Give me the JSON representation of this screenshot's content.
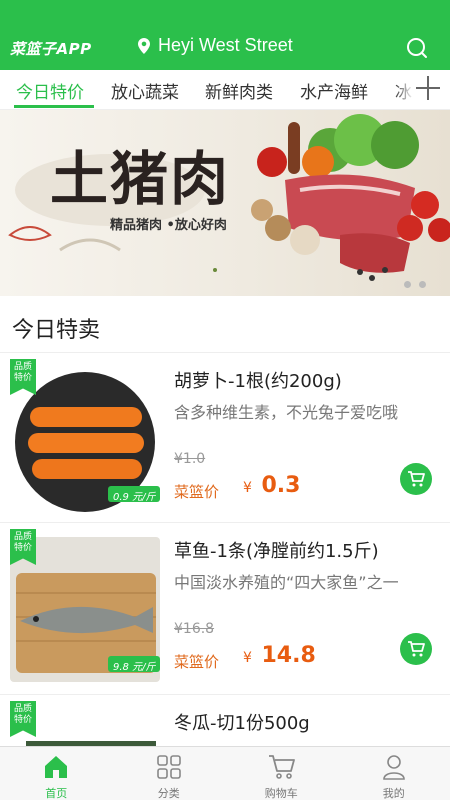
{
  "header": {
    "logo": "菜篮子APP",
    "location": "Heyi West Street"
  },
  "tabs": [
    "今日特价",
    "放心蔬菜",
    "新鲜肉类",
    "水产海鲜",
    "冰"
  ],
  "banner": {
    "title": "土猪肉",
    "subtitle": "精品猪肉 •放心好肉"
  },
  "section": {
    "title": "今日特卖"
  },
  "products": [
    {
      "tag": "品质特价",
      "name": "胡萝卜-1根(约200g)",
      "desc": "含多种维生素，不光兔子爱吃哦",
      "old_price": "¥1.0",
      "label": "菜篮价",
      "currency": "¥",
      "price": "0.3",
      "badge_price": "0.9",
      "badge_unit": "元/斤"
    },
    {
      "tag": "品质特价",
      "name": "草鱼-1条(净膛前约1.5斤)",
      "desc": "中国淡水养殖的“四大家鱼”之一",
      "old_price": "¥16.8",
      "label": "菜篮价",
      "currency": "¥",
      "price": "14.8",
      "badge_price": "9.8",
      "badge_unit": "元/斤"
    },
    {
      "tag": "品质特价",
      "name": "冬瓜-切1份500g"
    }
  ],
  "nav": [
    {
      "label": "首页",
      "icon": "home-icon",
      "active": true
    },
    {
      "label": "分类",
      "icon": "category-icon",
      "active": false
    },
    {
      "label": "购物车",
      "icon": "cart-icon",
      "active": false
    },
    {
      "label": "我的",
      "icon": "user-icon",
      "active": false
    }
  ],
  "colors": {
    "accent": "#2bbf4b",
    "price": "#e85c10"
  }
}
